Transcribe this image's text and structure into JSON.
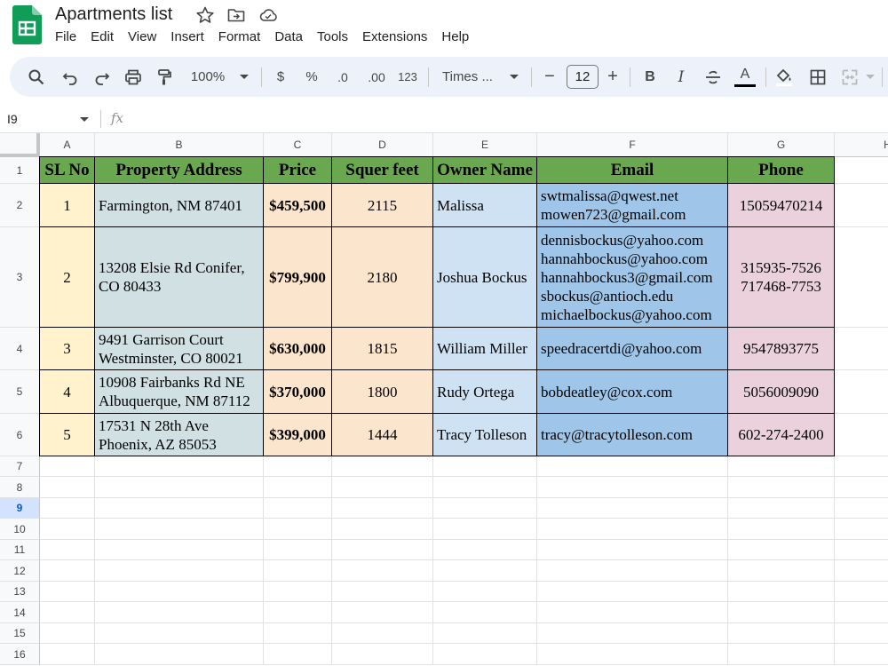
{
  "app": {
    "title": "Apartments list",
    "menu": [
      "File",
      "Edit",
      "View",
      "Insert",
      "Format",
      "Data",
      "Tools",
      "Extensions",
      "Help"
    ]
  },
  "toolbar": {
    "zoom": "100%",
    "currency": "$",
    "percent": "%",
    "decrease_decimals": ".0",
    "increase_decimals": ".00",
    "number_format": "123",
    "font": "Times ...",
    "font_size": "12",
    "minus": "−",
    "plus": "+",
    "bold": "B",
    "italic": "I",
    "text_color_glyph": "A"
  },
  "formula_bar": {
    "cell_ref": "I9",
    "fx": "fx",
    "value": ""
  },
  "columns": [
    "A",
    "B",
    "C",
    "D",
    "E",
    "F",
    "G",
    "H"
  ],
  "rows": [
    "1",
    "2",
    "3",
    "4",
    "5",
    "6",
    "7",
    "8",
    "9",
    "10",
    "11",
    "12",
    "13",
    "14",
    "15",
    "16"
  ],
  "selected_row": "9",
  "table": {
    "headers": [
      "SL No",
      "Property Address",
      "Price",
      "Squer feet",
      "Owner Name",
      "Email",
      "Phone"
    ],
    "rows": [
      {
        "sl": "1",
        "address": [
          "Farmington, NM 87401"
        ],
        "price": "$459,500",
        "sqft": "2115",
        "owner": "Malissa",
        "email": [
          "swtmalissa@qwest.net",
          "mowen723@gmail.com"
        ],
        "phone": [
          "15059470214"
        ]
      },
      {
        "sl": "2",
        "address": [
          "13208 Elsie Rd Conifer,",
          "CO 80433"
        ],
        "price": "$799,900",
        "sqft": "2180",
        "owner": "Joshua Bockus",
        "email": [
          "dennisbockus@yahoo.com",
          "hannahbockus@yahoo.com",
          "hannahbockus3@gmail.com",
          "sbockus@antioch.edu",
          "michaelbockus@yahoo.com"
        ],
        "phone": [
          "315935-7526",
          "717468-7753"
        ]
      },
      {
        "sl": "3",
        "address": [
          "9491 Garrison Court",
          "Westminster, CO 80021"
        ],
        "price": "$630,000",
        "sqft": "1815",
        "owner": "William Miller",
        "email": [
          "speedracertdi@yahoo.com"
        ],
        "phone": [
          "9547893775"
        ]
      },
      {
        "sl": "4",
        "address": [
          "10908 Fairbanks Rd NE",
          "Albuquerque, NM 87112"
        ],
        "price": "$370,000",
        "sqft": "1800",
        "owner": "Rudy Ortega",
        "email": [
          "bobdeatley@cox.com"
        ],
        "phone": [
          "5056009090"
        ]
      },
      {
        "sl": "5",
        "address": [
          "17531 N 28th Ave",
          "Phoenix, AZ 85053"
        ],
        "price": "$399,000",
        "sqft": "1444",
        "owner": "Tracy Tolleson",
        "email": [
          "tracy@tracytolleson.com"
        ],
        "phone": [
          "602-274-2400"
        ]
      }
    ]
  },
  "colors": {
    "header_green": "#6aa84f",
    "sl_yellow": "#fff2cc",
    "address_teal": "#d0e0e3",
    "price_orange": "#fce5cd",
    "owner_blue": "#cfe2f3",
    "email_blue": "#9fc5e8",
    "phone_pink": "#ead1dc"
  }
}
